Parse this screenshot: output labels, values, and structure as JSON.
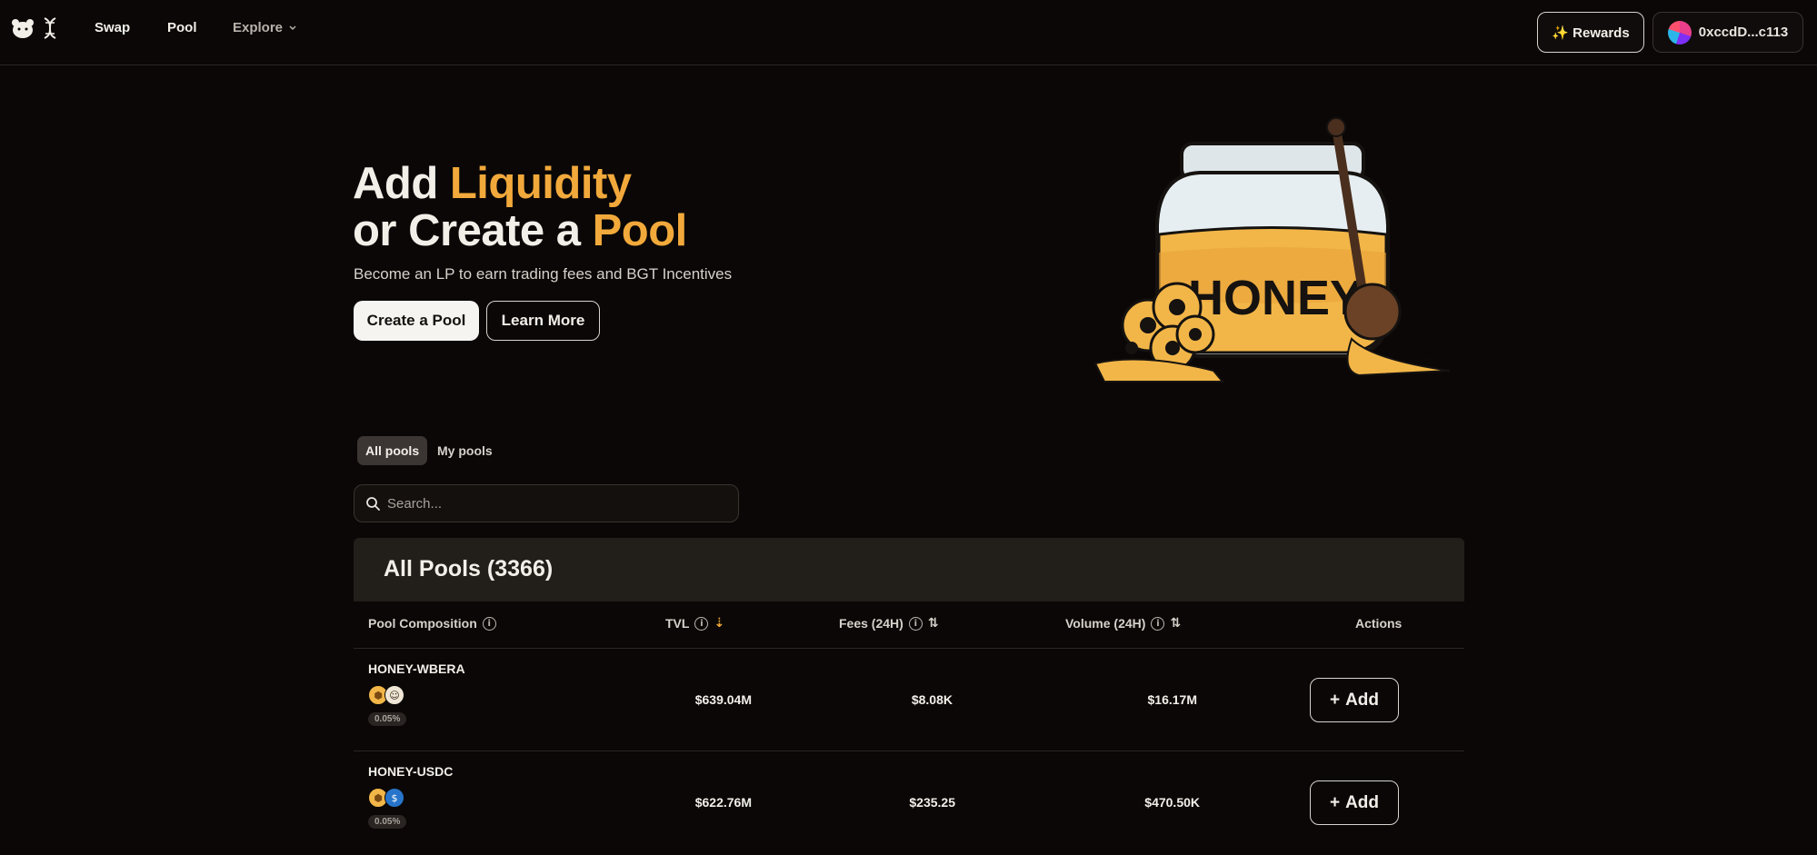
{
  "nav": {
    "links": [
      {
        "label": "Swap"
      },
      {
        "label": "Pool"
      },
      {
        "label": "Explore"
      }
    ],
    "rewards_label": "✨ Rewards",
    "wallet_label": "0xccdD...c113"
  },
  "hero": {
    "title_part1": "Add ",
    "title_accent1": "Liquidity",
    "title_part2": "or Create a ",
    "title_accent2": "Pool",
    "subtitle": "Become an LP to earn trading fees and BGT Incentives",
    "primary_button": "Create a Pool",
    "secondary_button": "Learn More",
    "jar_label": "HONEY"
  },
  "tabs": [
    {
      "label": "All pools",
      "active": true
    },
    {
      "label": "My pools",
      "active": false
    }
  ],
  "search": {
    "placeholder": "Search..."
  },
  "table": {
    "title": "All Pools (3366)",
    "columns": {
      "composition": "Pool Composition",
      "tvl": "TVL",
      "fees": "Fees (24H)",
      "volume": "Volume (24H)",
      "actions": "Actions"
    },
    "add_label": "Add",
    "rows": [
      {
        "name": "HONEY-WBERA",
        "fee": "0.05%",
        "tvl": "$639.04M",
        "fees": "$8.08K",
        "volume": "$16.17M",
        "tokens": [
          "honey-token-icon",
          "wbera-token-icon"
        ]
      },
      {
        "name": "HONEY-USDC",
        "fee": "0.05%",
        "tvl": "$622.76M",
        "fees": "$235.25",
        "volume": "$470.50K",
        "tokens": [
          "honey-token-icon",
          "usdc-token-icon"
        ]
      }
    ]
  },
  "colors": {
    "background": "#0a0706",
    "accent": "#f2a93b",
    "table_header": "#221e1a"
  }
}
